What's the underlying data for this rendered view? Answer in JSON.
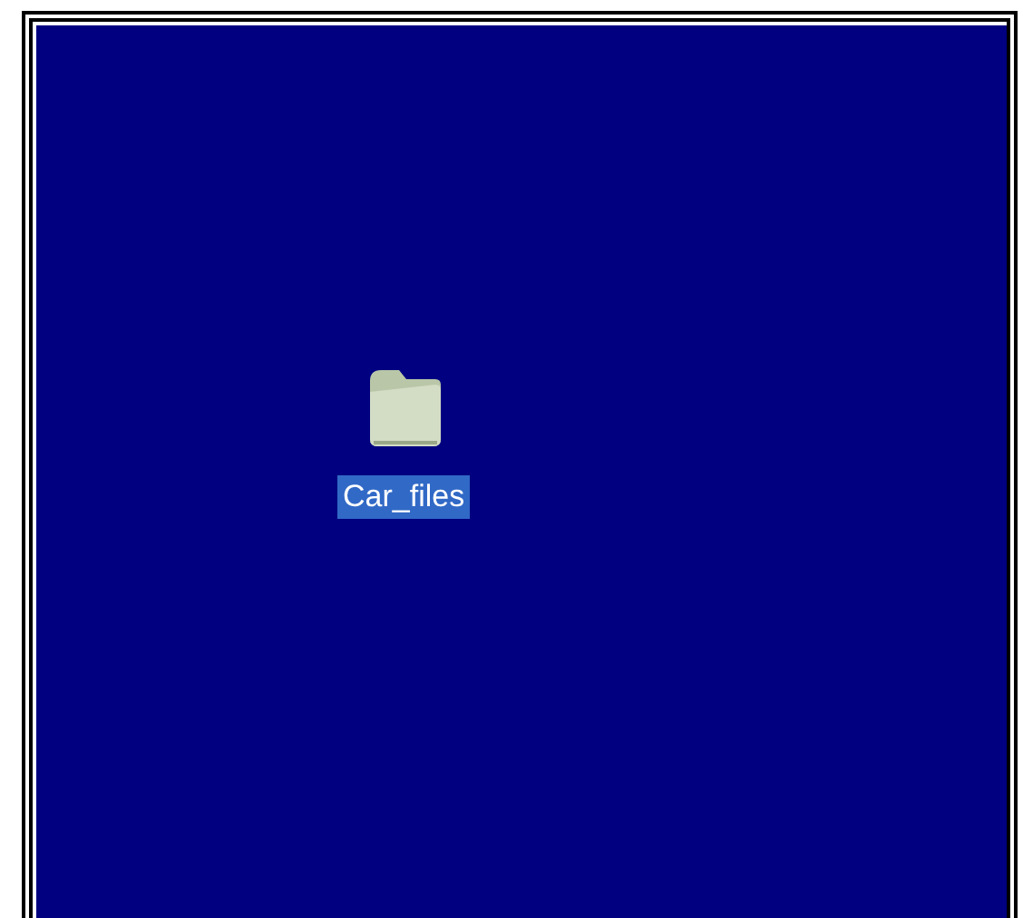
{
  "desktop": {
    "icons": [
      {
        "label": "Car_files",
        "selected": true
      }
    ]
  }
}
